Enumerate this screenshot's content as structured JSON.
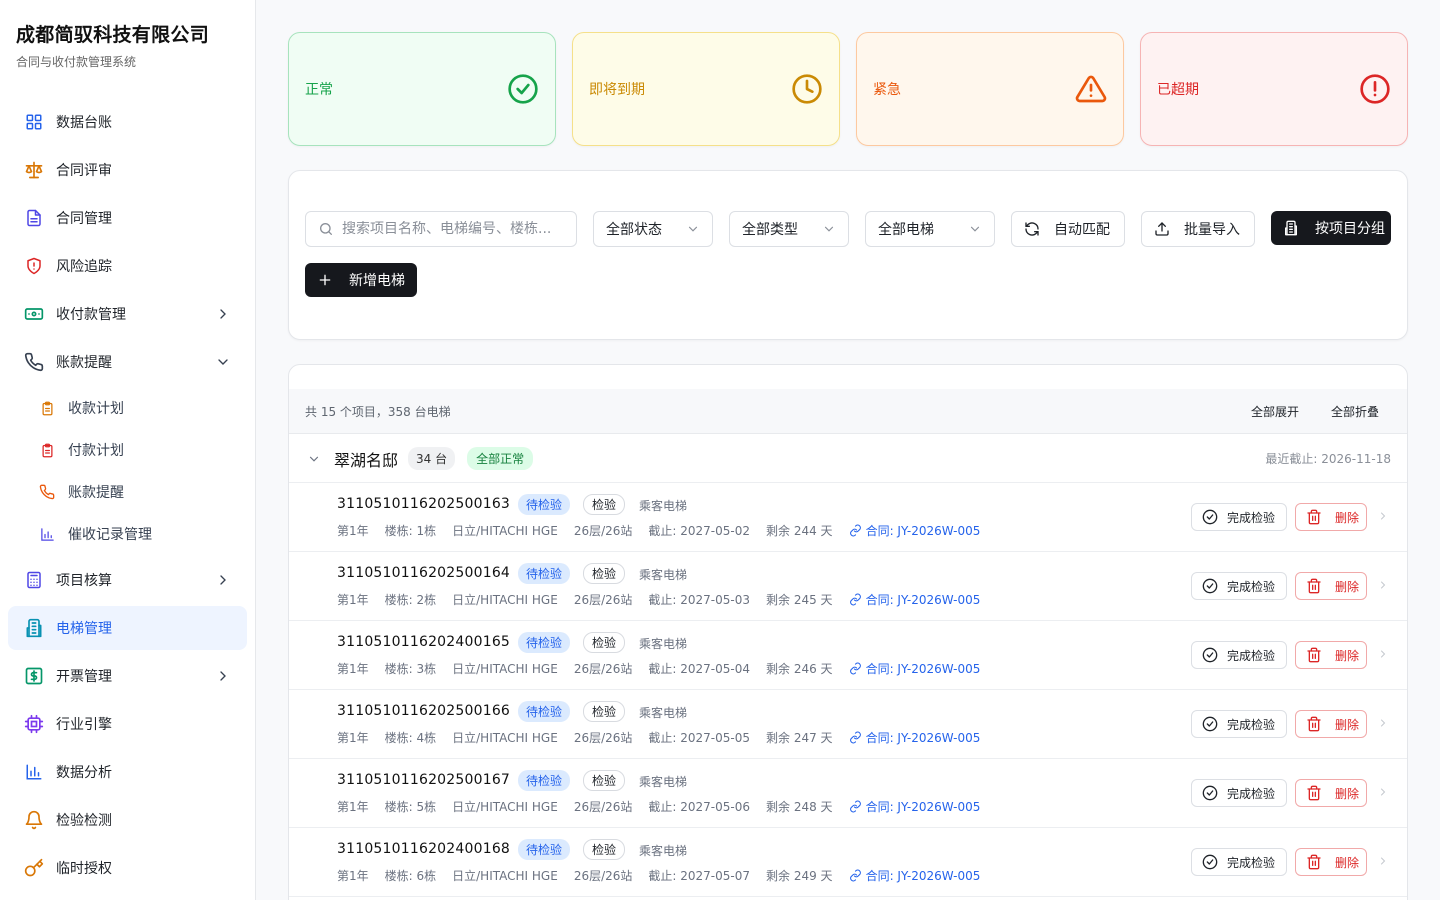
{
  "brand": {
    "title": "成都简驭科技有限公司",
    "subtitle": "合同与收付款管理系统"
  },
  "sidebar": {
    "items": [
      {
        "label": "数据台账",
        "icon": "grid-icon"
      },
      {
        "label": "合同评审",
        "icon": "scale-icon"
      },
      {
        "label": "合同管理",
        "icon": "document-icon"
      },
      {
        "label": "风险追踪",
        "icon": "shield-alert-icon"
      },
      {
        "label": "收付款管理",
        "icon": "banknote-icon"
      },
      {
        "label": "账款提醒",
        "icon": "phone-icon"
      },
      {
        "label": "项目核算",
        "icon": "calculator-icon"
      },
      {
        "label": "电梯管理",
        "icon": "building-icon"
      },
      {
        "label": "开票管理",
        "icon": "receipt-icon"
      },
      {
        "label": "行业引擎",
        "icon": "cpu-icon"
      },
      {
        "label": "数据分析",
        "icon": "bar-chart-icon"
      },
      {
        "label": "检验检测",
        "icon": "bell-icon"
      },
      {
        "label": "临时授权",
        "icon": "key-icon"
      }
    ],
    "subitems": [
      {
        "label": "收款计划"
      },
      {
        "label": "付款计划"
      },
      {
        "label": "账款提醒"
      },
      {
        "label": "催收记录管理"
      }
    ]
  },
  "status_cards": [
    {
      "label": "正常",
      "color": "#16a34a",
      "icon": "check-circle-icon"
    },
    {
      "label": "即将到期",
      "color": "#ca8a04",
      "icon": "clock-icon"
    },
    {
      "label": "紧急",
      "color": "#ea580c",
      "icon": "warning-triangle-icon"
    },
    {
      "label": "已超期",
      "color": "#dc2626",
      "icon": "alert-circle-icon"
    }
  ],
  "toolbar": {
    "search_placeholder": "搜索项目名称、电梯编号、楼栋...",
    "status_select": "全部状态",
    "type_select": "全部类型",
    "elevator_select": "全部电梯",
    "auto_match": "自动匹配",
    "batch_import": "批量导入",
    "group_by_project": "按项目分组",
    "add_elevator": "新增电梯"
  },
  "list": {
    "summary": "共 15 个项目，358 台电梯",
    "expand_all": "全部展开",
    "collapse_all": "全部折叠",
    "group": {
      "name": "翠湖名邸",
      "count": "34 台",
      "status": "全部正常",
      "latest_deadline": "最近截止: 2026-11-18"
    },
    "rows": [
      {
        "id": "3110510116202500163",
        "status": "待检验",
        "kind": "检验",
        "type": "乘客电梯",
        "year": "第1年",
        "building": "楼栋: 1栋",
        "brand": "日立/HITACHI HGE",
        "floors": "26层/26站",
        "deadline": "截止: 2027-05-02",
        "remaining": "剩余 244 天",
        "contract": "合同: JY-2026W-005",
        "done_label": "完成检验",
        "delete_label": "删除"
      },
      {
        "id": "3110510116202500164",
        "status": "待检验",
        "kind": "检验",
        "type": "乘客电梯",
        "year": "第1年",
        "building": "楼栋: 2栋",
        "brand": "日立/HITACHI HGE",
        "floors": "26层/26站",
        "deadline": "截止: 2027-05-03",
        "remaining": "剩余 245 天",
        "contract": "合同: JY-2026W-005",
        "done_label": "完成检验",
        "delete_label": "删除"
      },
      {
        "id": "3110510116202400165",
        "status": "待检验",
        "kind": "检验",
        "type": "乘客电梯",
        "year": "第1年",
        "building": "楼栋: 3栋",
        "brand": "日立/HITACHI HGE",
        "floors": "26层/26站",
        "deadline": "截止: 2027-05-04",
        "remaining": "剩余 246 天",
        "contract": "合同: JY-2026W-005",
        "done_label": "完成检验",
        "delete_label": "删除"
      },
      {
        "id": "3110510116202500166",
        "status": "待检验",
        "kind": "检验",
        "type": "乘客电梯",
        "year": "第1年",
        "building": "楼栋: 4栋",
        "brand": "日立/HITACHI HGE",
        "floors": "26层/26站",
        "deadline": "截止: 2027-05-05",
        "remaining": "剩余 247 天",
        "contract": "合同: JY-2026W-005",
        "done_label": "完成检验",
        "delete_label": "删除"
      },
      {
        "id": "3110510116202500167",
        "status": "待检验",
        "kind": "检验",
        "type": "乘客电梯",
        "year": "第1年",
        "building": "楼栋: 5栋",
        "brand": "日立/HITACHI HGE",
        "floors": "26层/26站",
        "deadline": "截止: 2027-05-06",
        "remaining": "剩余 248 天",
        "contract": "合同: JY-2026W-005",
        "done_label": "完成检验",
        "delete_label": "删除"
      },
      {
        "id": "3110510116202400168",
        "status": "待检验",
        "kind": "检验",
        "type": "乘客电梯",
        "year": "第1年",
        "building": "楼栋: 6栋",
        "brand": "日立/HITACHI HGE",
        "floors": "26层/26站",
        "deadline": "截止: 2027-05-07",
        "remaining": "剩余 249 天",
        "contract": "合同: JY-2026W-005",
        "done_label": "完成检验",
        "delete_label": "删除"
      }
    ]
  }
}
